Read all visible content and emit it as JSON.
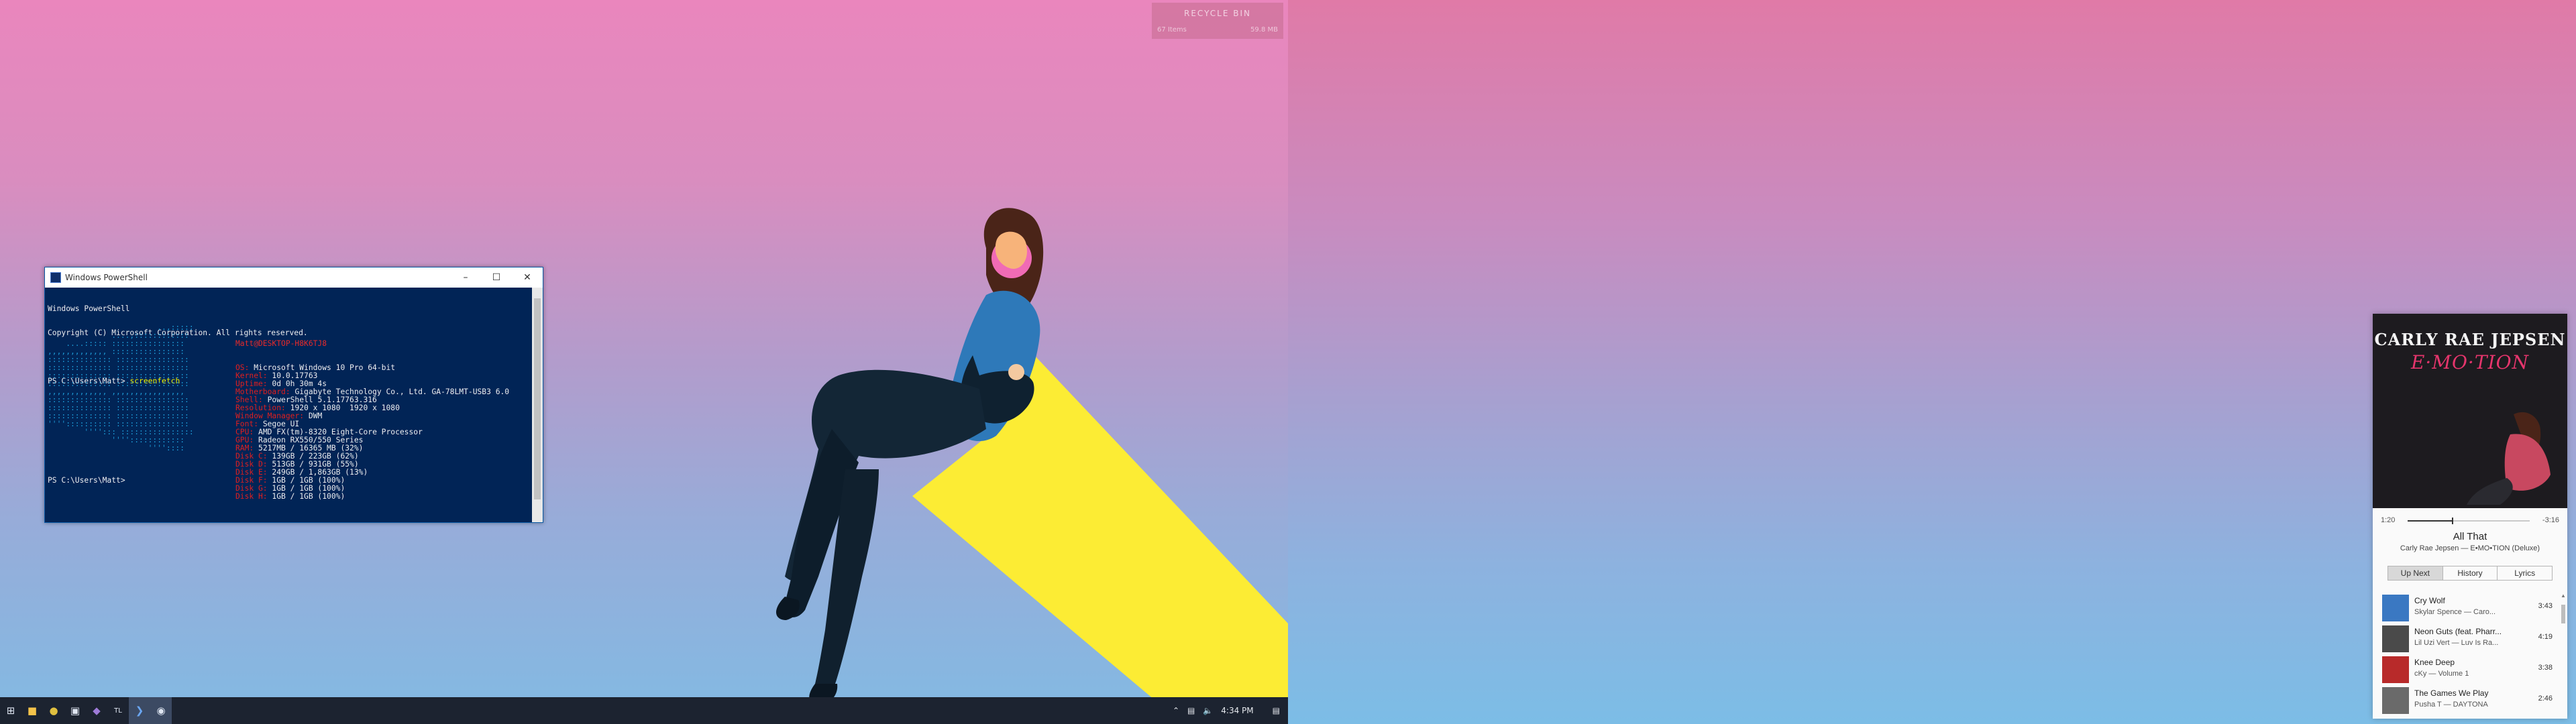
{
  "recycle_bin": {
    "title": "RECYCLE BIN",
    "items": "67 Items",
    "size": "59.8 MB"
  },
  "powershell": {
    "title": "Windows PowerShell",
    "header_line1": "Windows PowerShell",
    "header_line2": "Copyright (C) Microsoft Corporation. All rights reserved.",
    "prompt1": "PS C:\\Users\\Matt> ",
    "command": "screenfetch",
    "prompt2": "PS C:\\Users\\Matt>",
    "user_host": "Matt@DESKTOP-H8K6TJ8",
    "info": [
      {
        "key": "OS:",
        "value": "Microsoft Windows 10 Pro 64-bit"
      },
      {
        "key": "Kernel:",
        "value": "10.0.17763"
      },
      {
        "key": "Uptime:",
        "value": "0d 0h 30m 4s"
      },
      {
        "key": "Motherboard:",
        "value": "Gigabyte Technology Co., Ltd. GA-78LMT-USB3 6.0"
      },
      {
        "key": "Shell:",
        "value": "PowerShell 5.1.17763.316"
      },
      {
        "key": "Resolution:",
        "value": "1920 x 1080  1920 x 1080"
      },
      {
        "key": "Window Manager:",
        "value": "DWM"
      },
      {
        "key": "Font:",
        "value": "Segoe UI"
      },
      {
        "key": "CPU:",
        "value": "AMD FX(tm)-8320 Eight-Core Processor"
      },
      {
        "key": "GPU:",
        "value": "Radeon RX550/550 Series"
      },
      {
        "key": "RAM:",
        "value": "5217MB / 16365 MB (32%)"
      },
      {
        "key": "Disk C:",
        "value": "139GB / 223GB (62%)"
      },
      {
        "key": "Disk D:",
        "value": "513GB / 931GB (55%)"
      },
      {
        "key": "Disk E:",
        "value": "249GB / 1,863GB (13%)"
      },
      {
        "key": "Disk F:",
        "value": "1GB / 1GB (100%)"
      },
      {
        "key": "Disk G:",
        "value": "1GB / 1GB (100%)"
      },
      {
        "key": "Disk H:",
        "value": "1GB / 1GB (100%)"
      }
    ],
    "ascii_art": [
      "                        ..,:::::",
      "              ....,::::::::::::",
      "    ....::::: ::::::::::::::::",
      ",,,,,,,,,,,,, ::::::::::::::::",
      ":::::::::::::: ::::::::::::::::",
      ":::::::::::::: ::::::::::::::::",
      ":::::::::::::: ::::::::::::::::",
      ":::::::::::::: ::::::::::::::::",
      ",,,,,,,,,,,,, ,,,,,,,,,,,,,,,,",
      ":::::::::::::: ::::::::::::::::",
      ":::::::::::::: ::::::::::::::::",
      ":::::::::::::: ::::::::::::::::",
      "'''':::::::::: ::::::::::::::::",
      "        ''''::: ::::::::::::::::",
      "              ''''::::::::::::",
      "                      ''''::::"
    ]
  },
  "taskbar": {
    "icons": [
      "windows-start-icon",
      "folder-icon",
      "chrome-icon",
      "store-icon",
      "vs-icon",
      "app-icon",
      "powershell-icon",
      "groove-icon"
    ],
    "time": "4:34 PM"
  },
  "player": {
    "album_artist": "CARLY RAE JEPSEN",
    "album_title": "E·MO·TION",
    "current_time": "1:20",
    "remaining_time": "-3:16",
    "progress": 0.364,
    "track_title": "All That",
    "track_sub": "Carly Rae Jepsen — E•MO•TION  (Deluxe)",
    "tabs": [
      "Up Next",
      "History",
      "Lyrics"
    ],
    "active_tab": "Up Next",
    "queue": [
      {
        "title": "Cry Wolf",
        "sub": "Skylar Spence — Caro...",
        "duration": "3:43",
        "color": "#3a78c2"
      },
      {
        "title": "Neon Guts (feat. Pharr...",
        "sub": "Lil Uzi Vert — Luv Is Ra...",
        "duration": "4:19",
        "color": "#4a4a4a"
      },
      {
        "title": "Knee Deep",
        "sub": "cKy — Volume 1",
        "duration": "3:38",
        "color": "#b82a2a"
      },
      {
        "title": "The Games We Play",
        "sub": "Pusha T — DAYTONA",
        "duration": "2:46",
        "color": "#6a6a6a"
      }
    ]
  }
}
